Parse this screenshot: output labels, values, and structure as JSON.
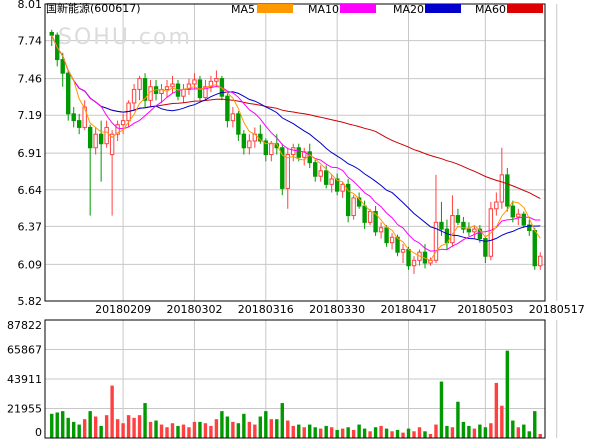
{
  "header": {
    "stock_label": "国新能源(600617)",
    "watermark": "SOHU.com"
  },
  "legend": [
    {
      "label": "MA5",
      "color": "#ff9900"
    },
    {
      "label": "MA10",
      "color": "#ff00ff"
    },
    {
      "label": "MA20",
      "color": "#0000cc"
    },
    {
      "label": "MA60",
      "color": "#dd0000"
    }
  ],
  "colors": {
    "up": "#ff4040",
    "down": "#009900",
    "grid": "#c8c8c8",
    "frame": "#000000",
    "ma5": "#ff9900",
    "ma10": "#ff00ff",
    "ma20": "#0000cc",
    "ma60": "#cc0000"
  },
  "chart_data": [
    {
      "type": "candlestick",
      "title": "国新能源(600617)",
      "y_ticks": [
        "8.01",
        "7.74",
        "7.46",
        "7.19",
        "6.91",
        "6.64",
        "6.37",
        "6.09",
        "5.82"
      ],
      "ylim": [
        5.82,
        8.01
      ],
      "x_tick_labels": [
        "20180209",
        "20180302",
        "20180316",
        "20180330",
        "20180417",
        "20180503",
        "20180517"
      ],
      "x_tick_index": [
        13,
        26,
        39,
        52,
        65,
        79,
        92
      ],
      "candles": [
        [
          7.8,
          7.82,
          7.7,
          7.78
        ],
        [
          7.78,
          7.8,
          7.55,
          7.6
        ],
        [
          7.6,
          7.65,
          7.4,
          7.5
        ],
        [
          7.5,
          7.52,
          7.15,
          7.2
        ],
        [
          7.2,
          7.25,
          7.1,
          7.15
        ],
        [
          7.15,
          7.2,
          7.05,
          7.1
        ],
        [
          7.1,
          7.3,
          7.08,
          7.25
        ],
        [
          7.1,
          7.12,
          6.45,
          6.95
        ],
        [
          6.95,
          7.1,
          6.9,
          7.05
        ],
        [
          7.05,
          7.15,
          6.7,
          6.98
        ],
        [
          6.98,
          7.15,
          6.95,
          7.1
        ],
        [
          6.9,
          7.08,
          6.45,
          7.05
        ],
        [
          7.05,
          7.15,
          7.0,
          7.12
        ],
        [
          7.12,
          7.2,
          7.05,
          7.15
        ],
        [
          7.15,
          7.3,
          7.1,
          7.28
        ],
        [
          7.28,
          7.42,
          7.22,
          7.38
        ],
        [
          7.38,
          7.48,
          7.3,
          7.46
        ],
        [
          7.46,
          7.5,
          7.25,
          7.3
        ],
        [
          7.3,
          7.45,
          7.25,
          7.4
        ],
        [
          7.4,
          7.45,
          7.3,
          7.35
        ],
        [
          7.35,
          7.42,
          7.28,
          7.38
        ],
        [
          7.38,
          7.45,
          7.32,
          7.4
        ],
        [
          7.4,
          7.48,
          7.35,
          7.42
        ],
        [
          7.42,
          7.45,
          7.3,
          7.33
        ],
        [
          7.33,
          7.42,
          7.28,
          7.38
        ],
        [
          7.38,
          7.46,
          7.34,
          7.42
        ],
        [
          7.42,
          7.5,
          7.38,
          7.45
        ],
        [
          7.45,
          7.48,
          7.3,
          7.32
        ],
        [
          7.32,
          7.45,
          7.3,
          7.4
        ],
        [
          7.4,
          7.48,
          7.36,
          7.44
        ],
        [
          7.44,
          7.52,
          7.4,
          7.46
        ],
        [
          7.46,
          7.48,
          7.3,
          7.33
        ],
        [
          7.33,
          7.35,
          7.1,
          7.15
        ],
        [
          7.15,
          7.25,
          7.1,
          7.2
        ],
        [
          7.2,
          7.22,
          7.0,
          7.05
        ],
        [
          7.05,
          7.08,
          6.9,
          6.95
        ],
        [
          6.95,
          7.05,
          6.9,
          7.0
        ],
        [
          7.0,
          7.1,
          6.95,
          7.05
        ],
        [
          7.05,
          7.12,
          6.98,
          7.0
        ],
        [
          7.0,
          7.02,
          6.85,
          6.9
        ],
        [
          6.9,
          7.0,
          6.85,
          6.98
        ],
        [
          6.98,
          7.05,
          6.9,
          6.95
        ],
        [
          6.95,
          6.98,
          6.6,
          6.65
        ],
        [
          6.65,
          6.95,
          6.5,
          6.9
        ],
        [
          6.9,
          6.98,
          6.85,
          6.95
        ],
        [
          6.95,
          6.98,
          6.85,
          6.88
        ],
        [
          6.88,
          6.95,
          6.82,
          6.92
        ],
        [
          6.92,
          6.98,
          6.8,
          6.84
        ],
        [
          6.84,
          6.86,
          6.7,
          6.74
        ],
        [
          6.74,
          6.82,
          6.7,
          6.78
        ],
        [
          6.78,
          6.82,
          6.65,
          6.68
        ],
        [
          6.68,
          6.75,
          6.62,
          6.72
        ],
        [
          6.72,
          6.76,
          6.6,
          6.63
        ],
        [
          6.63,
          6.7,
          6.58,
          6.68
        ],
        [
          6.68,
          6.72,
          6.4,
          6.45
        ],
        [
          6.45,
          6.6,
          6.42,
          6.58
        ],
        [
          6.58,
          6.62,
          6.5,
          6.52
        ],
        [
          6.52,
          6.56,
          6.35,
          6.4
        ],
        [
          6.4,
          6.5,
          6.38,
          6.48
        ],
        [
          6.48,
          6.52,
          6.3,
          6.33
        ],
        [
          6.33,
          6.4,
          6.28,
          6.36
        ],
        [
          6.36,
          6.38,
          6.22,
          6.25
        ],
        [
          6.25,
          6.32,
          6.2,
          6.29
        ],
        [
          6.29,
          6.31,
          6.15,
          6.18
        ],
        [
          6.18,
          6.24,
          6.1,
          6.2
        ],
        [
          6.2,
          6.22,
          6.05,
          6.08
        ],
        [
          6.08,
          6.15,
          6.02,
          6.12
        ],
        [
          6.12,
          6.2,
          6.08,
          6.18
        ],
        [
          6.18,
          6.24,
          6.06,
          6.1
        ],
        [
          6.1,
          6.14,
          6.08,
          6.12
        ],
        [
          6.12,
          6.75,
          6.1,
          6.4
        ],
        [
          6.4,
          6.55,
          6.3,
          6.35
        ],
        [
          6.35,
          6.42,
          6.2,
          6.25
        ],
        [
          6.25,
          6.6,
          6.22,
          6.45
        ],
        [
          6.45,
          6.5,
          6.38,
          6.4
        ],
        [
          6.4,
          6.44,
          6.32,
          6.35
        ],
        [
          6.35,
          6.4,
          6.3,
          6.33
        ],
        [
          6.33,
          6.38,
          6.28,
          6.35
        ],
        [
          6.35,
          6.38,
          6.25,
          6.28
        ],
        [
          6.28,
          6.3,
          6.1,
          6.15
        ],
        [
          6.15,
          6.55,
          6.12,
          6.5
        ],
        [
          6.5,
          6.62,
          6.45,
          6.55
        ],
        [
          6.55,
          6.95,
          6.5,
          6.75
        ],
        [
          6.75,
          6.8,
          6.48,
          6.52
        ],
        [
          6.52,
          6.56,
          6.4,
          6.44
        ],
        [
          6.44,
          6.5,
          6.38,
          6.46
        ],
        [
          6.46,
          6.48,
          6.36,
          6.38
        ],
        [
          6.38,
          6.42,
          6.3,
          6.34
        ],
        [
          6.34,
          6.36,
          6.05,
          6.08
        ],
        [
          6.08,
          6.18,
          6.05,
          6.15
        ]
      ],
      "volumes": [
        18000,
        19000,
        20000,
        15000,
        12000,
        10000,
        14000,
        20000,
        16000,
        9000,
        17000,
        39000,
        14000,
        11000,
        17000,
        15000,
        17000,
        26000,
        12000,
        13000,
        10000,
        8000,
        11000,
        9000,
        10000,
        8000,
        12000,
        12000,
        11000,
        9000,
        14000,
        20000,
        16000,
        12000,
        11000,
        18000,
        12000,
        10000,
        16000,
        20000,
        14000,
        14000,
        26000,
        13000,
        9000,
        10000,
        8000,
        10000,
        8000,
        7000,
        9000,
        8000,
        6000,
        7000,
        8000,
        6000,
        10000,
        7000,
        5000,
        8000,
        9000,
        7000,
        5000,
        6000,
        4000,
        7000,
        5000,
        8000,
        5000,
        3000,
        10000,
        42000,
        9000,
        8000,
        27000,
        12000,
        9000,
        7000,
        10000,
        8000,
        11000,
        41000,
        24000,
        65000,
        13000,
        8000,
        10000,
        5000,
        20000,
        3000
      ],
      "volume_ticks": [
        "87822",
        "65867",
        "43911",
        "21955",
        "0"
      ],
      "volume_max": 87822
    }
  ]
}
